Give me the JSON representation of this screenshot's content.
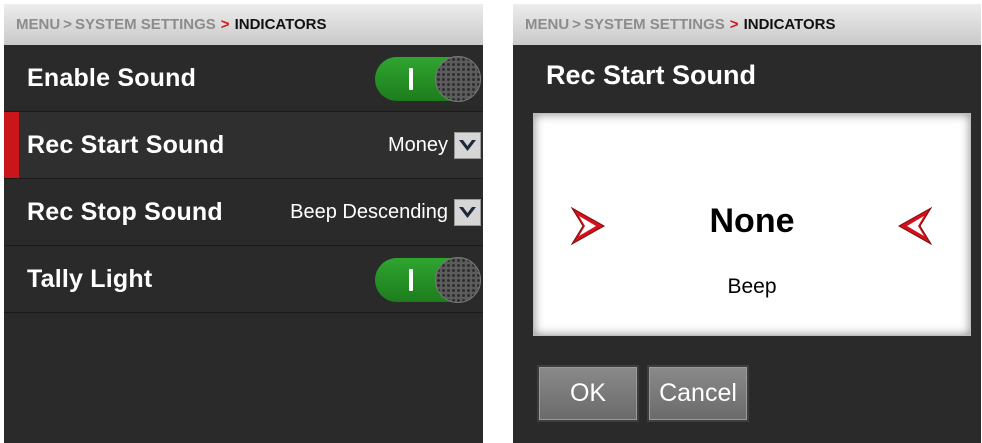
{
  "colors": {
    "panel_bg": "#2a2a2a",
    "accent_red": "#c8161b",
    "toggle_on": "#2fa52f",
    "button_gray": "#7a7a7a"
  },
  "left": {
    "breadcrumb": {
      "root": "MENU",
      "sep1": ">",
      "section": "SYSTEM SETTINGS",
      "sep2": ">",
      "current": "INDICATORS"
    },
    "rows": [
      {
        "label": "Enable Sound",
        "control": "toggle",
        "state": "on"
      },
      {
        "label": "Rec Start Sound",
        "control": "dropdown",
        "value": "Money",
        "selected": true
      },
      {
        "label": "Rec Stop Sound",
        "control": "dropdown",
        "value": "Beep Descending"
      },
      {
        "label": "Tally Light",
        "control": "toggle",
        "state": "on"
      }
    ],
    "icons": {
      "dropdown": "chevron-down-icon"
    }
  },
  "right": {
    "breadcrumb": {
      "root": "MENU",
      "sep1": ">",
      "section": "SYSTEM SETTINGS",
      "sep2": ">",
      "current": "INDICATORS"
    },
    "dialog": {
      "title": "Rec Start Sound",
      "selected_option": "None",
      "next_option": "Beep",
      "prev_icon": "arrow-right-icon",
      "next_icon": "arrow-left-icon",
      "ok_label": "OK",
      "cancel_label": "Cancel"
    }
  }
}
